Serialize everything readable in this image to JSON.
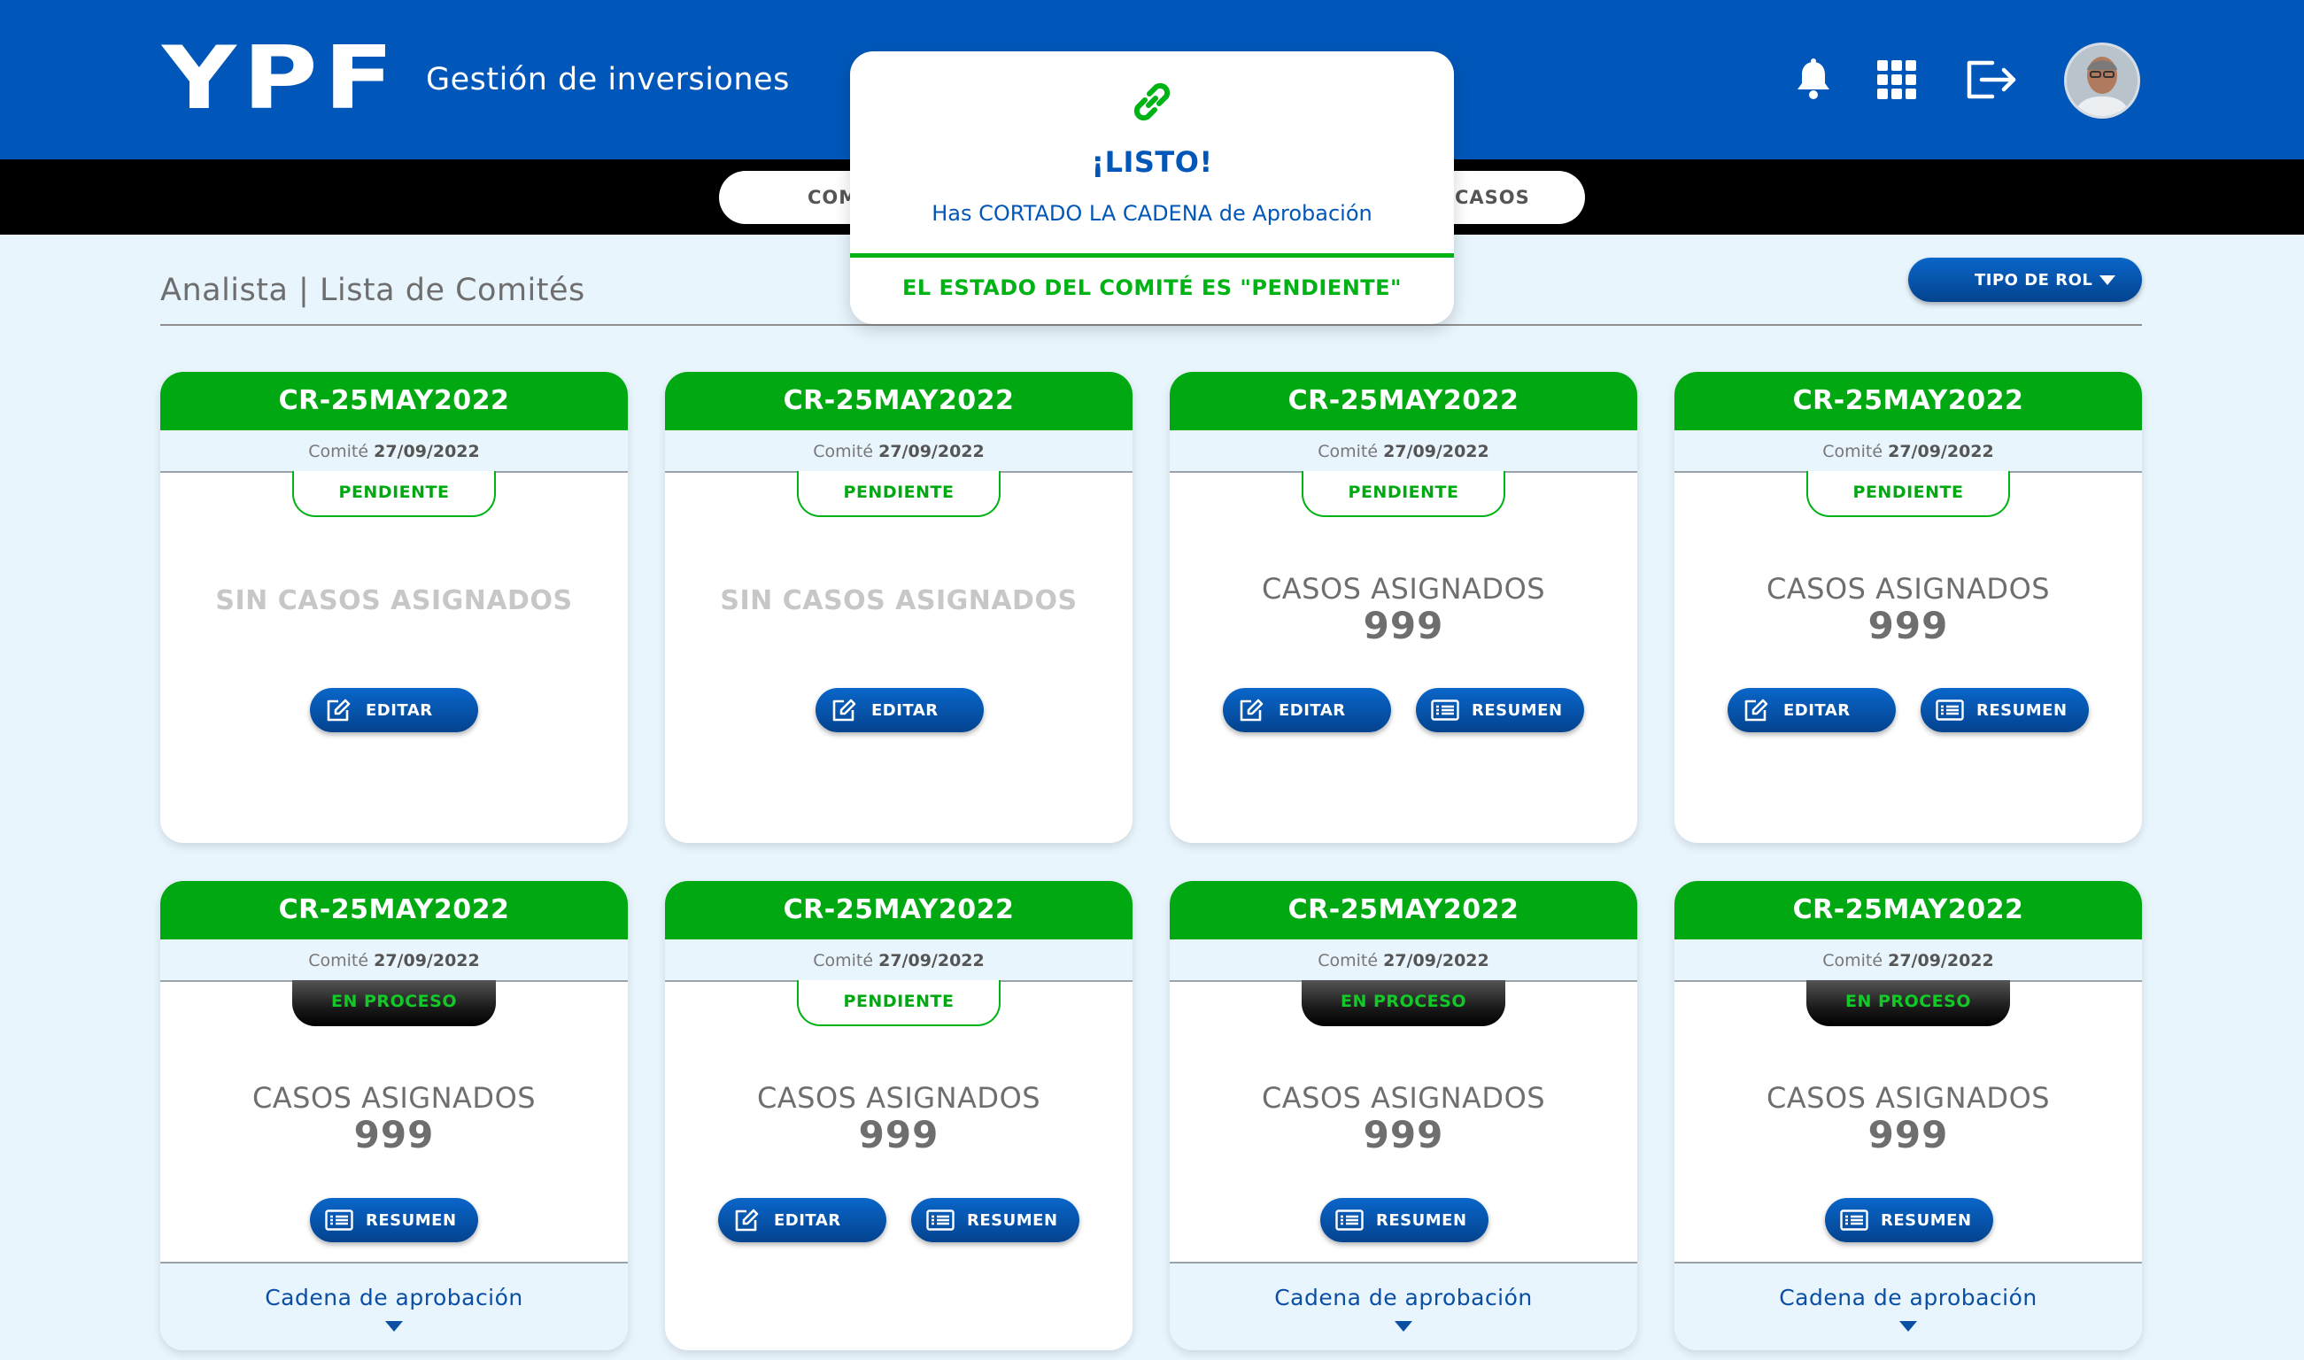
{
  "header": {
    "logo": "YPF",
    "app_title": "Gestión de inversiones",
    "icons": [
      "bell-icon",
      "apps-grid-icon",
      "logout-icon"
    ]
  },
  "nav": {
    "tab_left": "COM",
    "tab_right": "CASOS"
  },
  "section": {
    "title": "Analista | Lista de Comités",
    "role_button": "TIPO DE ROL"
  },
  "toast": {
    "title": "¡LISTO!",
    "message": "Has CORTADO LA CADENA de Aprobación",
    "status": "EL ESTADO DEL COMITÉ ES \"PENDIENTE\""
  },
  "labels": {
    "comite": "Comité",
    "sin_casos": "SIN CASOS ASIGNADOS",
    "casos_asignados": "CASOS ASIGNADOS",
    "editar": "EDITAR",
    "resumen": "RESUMEN",
    "cadena": "Cadena de aprobación"
  },
  "colors": {
    "brand_blue": "#0157b9",
    "header_green": "#00a911",
    "status_green": "#00b315"
  },
  "cards": [
    {
      "code": "CR-25MAY2022",
      "date": "27/09/2022",
      "status": "PENDIENTE",
      "casos": null
    },
    {
      "code": "CR-25MAY2022",
      "date": "27/09/2022",
      "status": "PENDIENTE",
      "casos": null
    },
    {
      "code": "CR-25MAY2022",
      "date": "27/09/2022",
      "status": "PENDIENTE",
      "casos": "999"
    },
    {
      "code": "CR-25MAY2022",
      "date": "27/09/2022",
      "status": "PENDIENTE",
      "casos": "999"
    },
    {
      "code": "CR-25MAY2022",
      "date": "27/09/2022",
      "status": "EN PROCESO",
      "casos": "999"
    },
    {
      "code": "CR-25MAY2022",
      "date": "27/09/2022",
      "status": "PENDIENTE",
      "casos": "999"
    },
    {
      "code": "CR-25MAY2022",
      "date": "27/09/2022",
      "status": "EN PROCESO",
      "casos": "999"
    },
    {
      "code": "CR-25MAY2022",
      "date": "27/09/2022",
      "status": "EN PROCESO",
      "casos": "999"
    }
  ]
}
